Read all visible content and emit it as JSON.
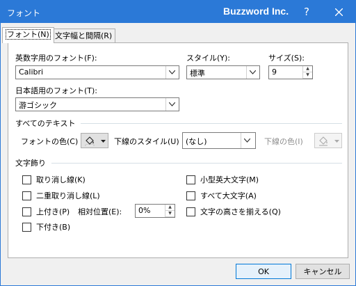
{
  "window": {
    "title": "フォント",
    "brand": "Buzzword Inc.",
    "help_icon": "question-mark-icon",
    "close_icon": "close-icon"
  },
  "tabs": [
    {
      "label": "フォント(N)",
      "active": true
    },
    {
      "label": "文字幅と間隔(R)",
      "active": false
    }
  ],
  "font": {
    "latin_label": "英数字用のフォント(F):",
    "latin_value": "Calibri",
    "jp_label": "日本語用のフォント(T):",
    "jp_value": "游ゴシック",
    "style_label": "スタイル(Y):",
    "style_value": "標準",
    "size_label": "サイズ(S):",
    "size_value": "9"
  },
  "all_text": {
    "section_label": "すべてのテキスト",
    "color_label": "フォントの色(C)",
    "underline_style_label": "下線のスタイル(U)",
    "underline_style_value": "(なし)",
    "underline_color_label": "下線の色(I)"
  },
  "effects": {
    "section_label": "文字飾り",
    "strikethrough": "取り消し線(K)",
    "double_strikethrough": "二重取り消し線(L)",
    "superscript": "上付き(P)",
    "offset_label": "相対位置(E):",
    "offset_value": "0%",
    "subscript": "下付き(B)",
    "small_caps": "小型英大文字(M)",
    "all_caps": "すべて大文字(A)",
    "equalize_height": "文字の高さを揃える(Q)"
  },
  "buttons": {
    "ok": "OK",
    "cancel": "キャンセル"
  },
  "colors": {
    "title_bar": "#2b79d7",
    "panel_bg": "#ffffff",
    "dialog_bg": "#f0f0f0",
    "default_button_border": "#0078d7"
  }
}
